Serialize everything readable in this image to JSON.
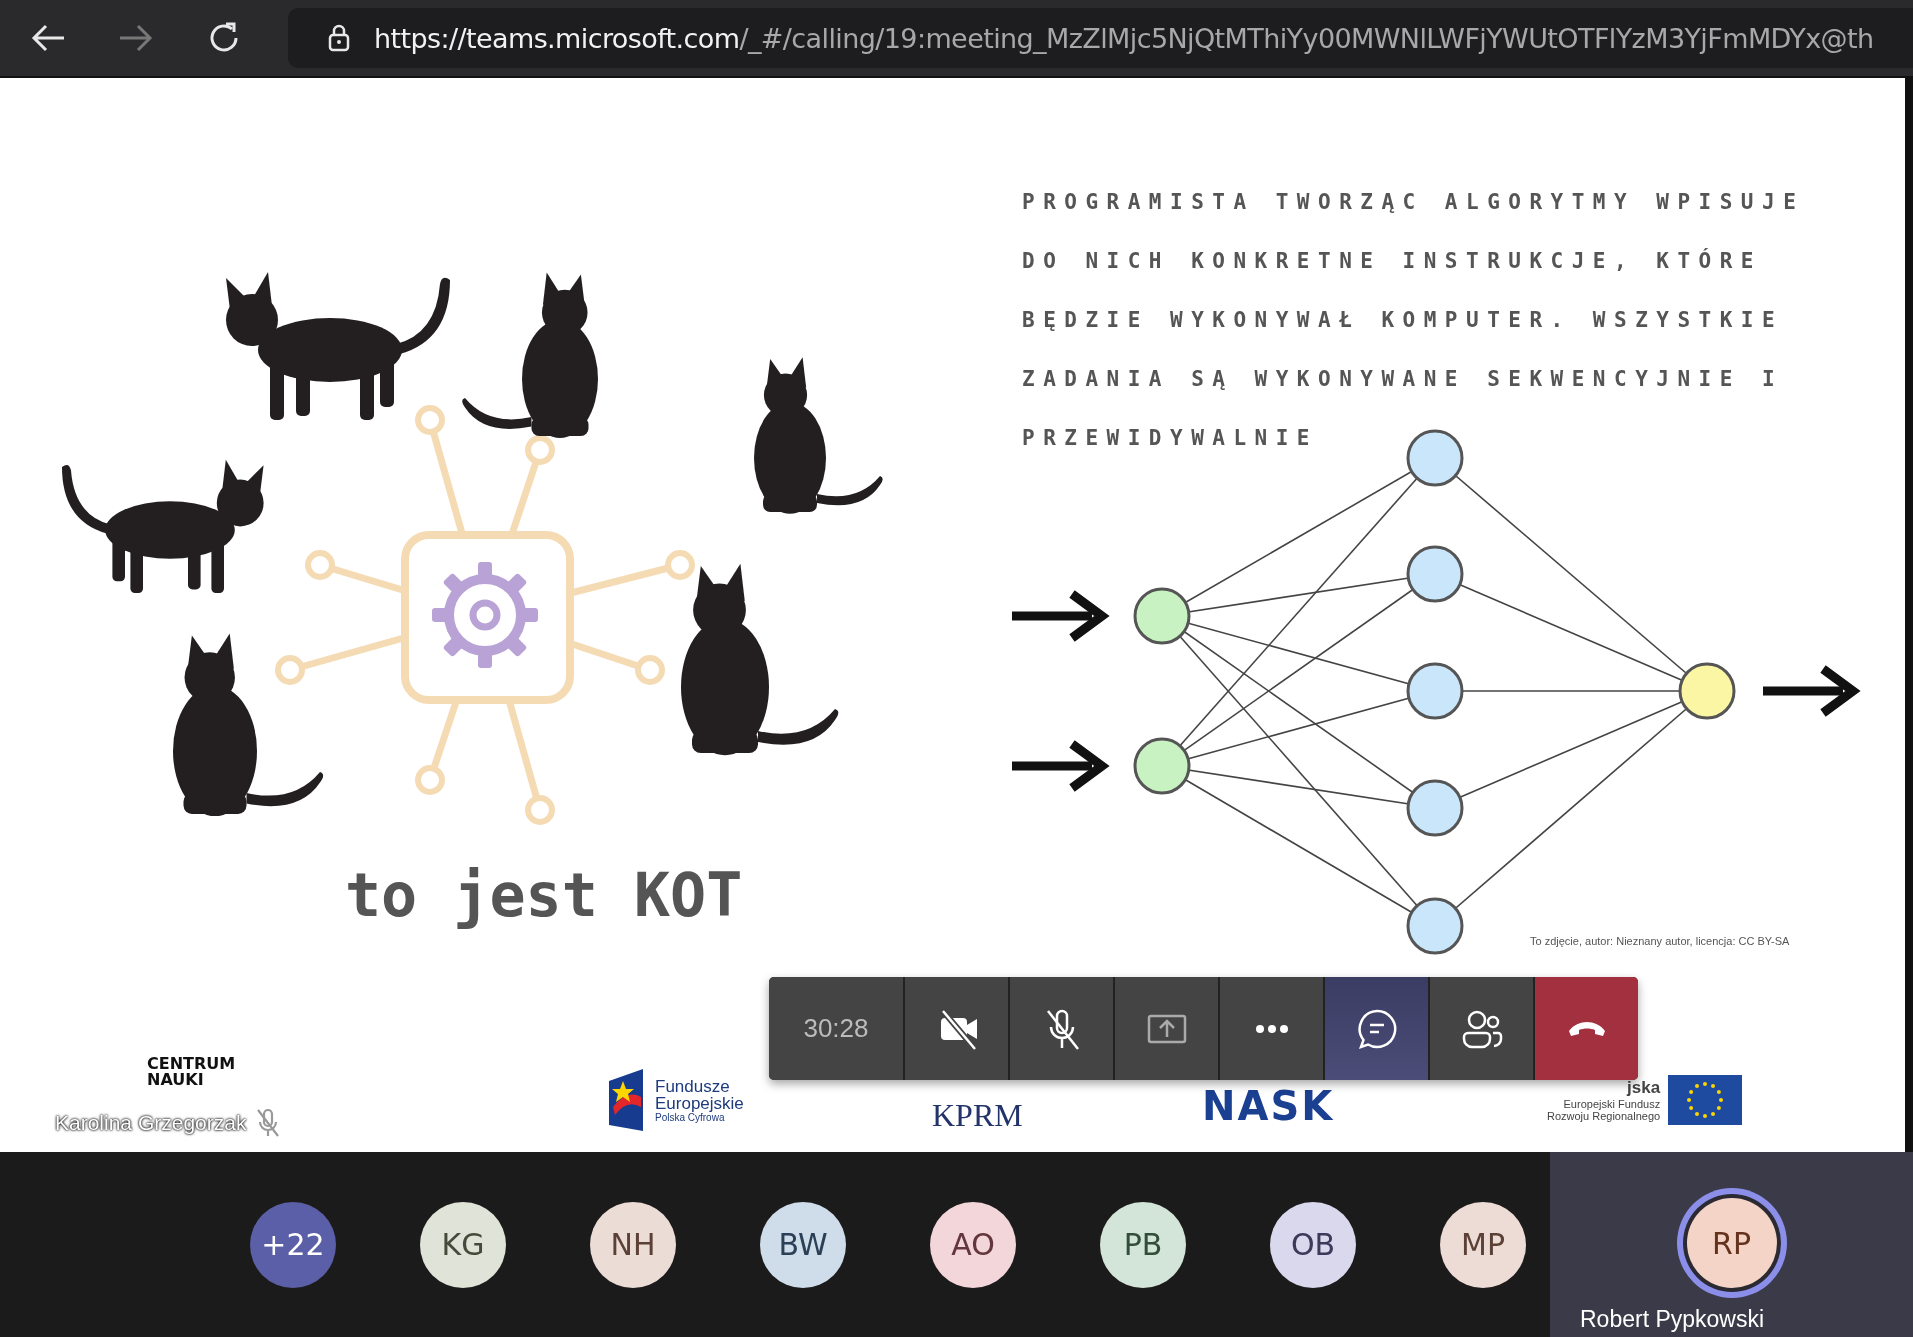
{
  "browser": {
    "url_host": "https://teams.microsoft.com",
    "url_path": "/_#/calling/19:meeting_MzZlMjc5NjQtMThiYy00MWNlLWFjYWUtOTFlYzM3YjFmMDYx@th",
    "forward_disabled": true
  },
  "slide": {
    "paragraph": "PROGRAMISTA TWORZĄC ALGORYTMY WPISUJE DO NICH KONKRETNE INSTRUKCJE, KTÓRE BĘDZIE WYKONYWAŁ KOMPUTER. WSZYSTKIE ZADANIA SĄ WYKONYWANE SEKWENCYJNIE I PRZEWIDYWALNIE",
    "caption": "to jest KOT",
    "credit": "To zdjęcie, autor: Nieznany autor, licencja: CC BY-SA",
    "logos": [
      {
        "kind": "cnk",
        "lines": [
          "CENTRUM",
          "NAUKI"
        ]
      },
      {
        "kind": "fe",
        "lines": [
          "Fundusze",
          "Europejskie",
          "Polska Cyfrowa"
        ]
      },
      {
        "kind": "kprm",
        "lines": [
          "KPRM"
        ]
      },
      {
        "kind": "nask",
        "lines": [
          "NASK"
        ]
      },
      {
        "kind": "ue",
        "lines": [
          "jska",
          "Europejski Fundusz",
          "Rozwoju Regionalnego"
        ]
      }
    ]
  },
  "presenter": {
    "name": "Karolina Grzegorzak",
    "muted": true
  },
  "call_controls": {
    "timer": "30:28",
    "buttons": [
      {
        "kind": "camera",
        "on": false,
        "selected": false
      },
      {
        "kind": "mic",
        "on": false,
        "selected": false
      },
      {
        "kind": "share",
        "selected": false
      },
      {
        "kind": "more",
        "selected": false
      },
      {
        "kind": "chat",
        "selected": true
      },
      {
        "kind": "people",
        "selected": false
      },
      {
        "kind": "hangup",
        "selected": false
      }
    ]
  },
  "participants": [
    {
      "initials": "+22",
      "color": "#5b5fa7"
    },
    {
      "initials": "KG",
      "color": "#dfe3d8"
    },
    {
      "initials": "NH",
      "color": "#ecdcd6"
    },
    {
      "initials": "BW",
      "color": "#cfdcea"
    },
    {
      "initials": "AO",
      "color": "#f2d6da"
    },
    {
      "initials": "PB",
      "color": "#d3e5d8"
    },
    {
      "initials": "OB",
      "color": "#d9d8ec"
    },
    {
      "initials": "MP",
      "color": "#eddcd6"
    }
  ],
  "self_tile": {
    "initials": "RP",
    "name": "Robert Pypkowski",
    "color": "#f3d4c6",
    "speaking": true
  }
}
